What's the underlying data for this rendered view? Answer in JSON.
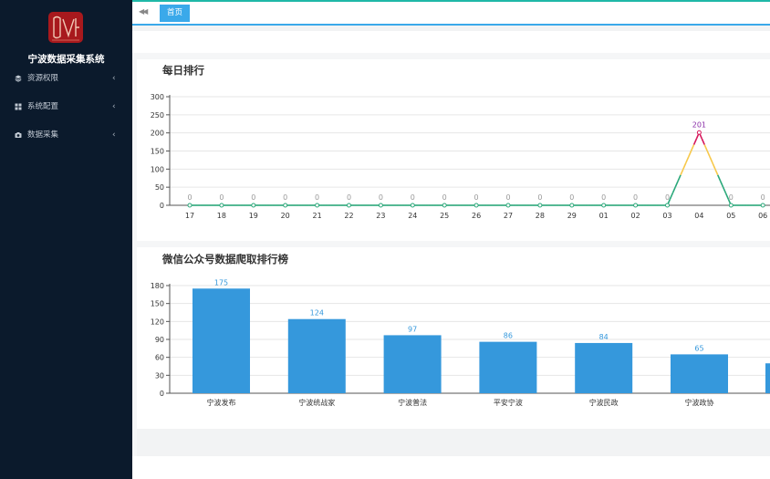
{
  "app": {
    "title": "宁波数据采集系统"
  },
  "sidebar": {
    "items": [
      {
        "label": "资源权限",
        "icon": "layers-icon"
      },
      {
        "label": "系统配置",
        "icon": "grid-icon"
      },
      {
        "label": "数据采集",
        "icon": "camera-icon"
      }
    ]
  },
  "tabs": [
    {
      "label": "首页"
    }
  ],
  "chart_data": [
    {
      "type": "line",
      "title": "每日排行",
      "x": [
        "17",
        "18",
        "19",
        "20",
        "21",
        "22",
        "23",
        "24",
        "25",
        "26",
        "27",
        "28",
        "29",
        "01",
        "02",
        "03",
        "04",
        "05",
        "06"
      ],
      "values": [
        0,
        0,
        0,
        0,
        0,
        0,
        0,
        0,
        0,
        0,
        0,
        0,
        0,
        0,
        0,
        0,
        201,
        0,
        0
      ],
      "data_labels": [
        "0",
        "0",
        "0",
        "0",
        "0",
        "0",
        "0",
        "0",
        "0",
        "0",
        "0",
        "0",
        "0",
        "0",
        "0",
        "0",
        "201",
        "0",
        "0"
      ],
      "ylim": [
        0,
        300
      ],
      "yticks": [
        0,
        50,
        100,
        150,
        200,
        250,
        300
      ],
      "grid": true,
      "colors": {
        "low": "#2aa87a",
        "mid": "#f7c84a",
        "high": "#d6185b",
        "label": "#999999",
        "peak_label": "#8a2fa8"
      }
    },
    {
      "type": "bar",
      "title": "微信公众号数据爬取排行榜",
      "categories": [
        "宁波发布",
        "宁波统战家",
        "宁波普法",
        "平安宁波",
        "宁波民政",
        "宁波政协"
      ],
      "values": [
        175,
        124,
        97,
        86,
        84,
        65
      ],
      "ylim": [
        0,
        180
      ],
      "yticks": [
        0,
        30,
        60,
        90,
        120,
        150,
        180
      ],
      "grid": true,
      "colors": {
        "bar": "#3598dc",
        "label": "#3598dc"
      }
    }
  ]
}
